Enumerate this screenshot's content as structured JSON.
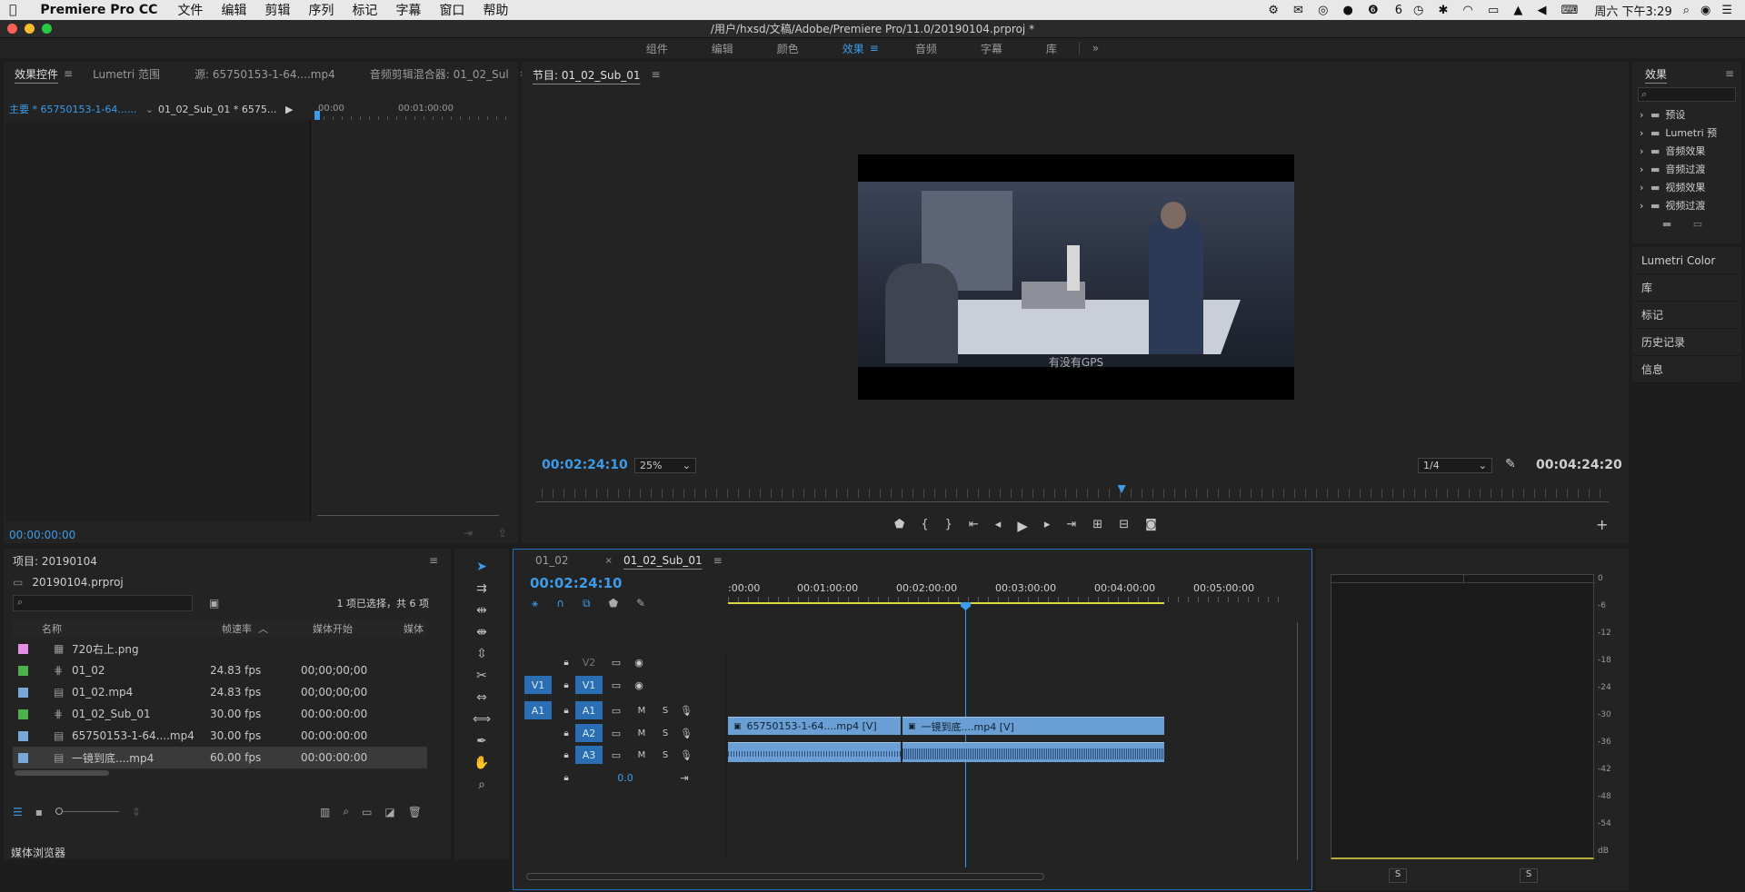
{
  "menubar": {
    "app": "Premiere Pro CC",
    "items": [
      "文件",
      "编辑",
      "剪辑",
      "序列",
      "标记",
      "字幕",
      "窗口",
      "帮助"
    ],
    "status_number": "6",
    "datetime": "周六 下午3:29"
  },
  "window": {
    "title": "/用户/hxsd/文稿/Adobe/Premiere Pro/11.0/20190104.prproj *"
  },
  "workspaces": {
    "items": [
      "组件",
      "编辑",
      "颜色",
      "效果",
      "音频",
      "字幕",
      "库"
    ],
    "active": "效果"
  },
  "effect_controls": {
    "tabs": [
      "效果控件",
      "Lumetri 范围",
      "源: 65750153-1-64....mp4",
      "音频剪辑混合器: 01_02_Sul"
    ],
    "master_clip": "主要 * 65750153-1-64......",
    "seq_clip": "01_02_Sub_01 * 6575...",
    "ruler": [
      "00:00",
      "00:01:00:00"
    ],
    "timecode": "00:00:00:00"
  },
  "program": {
    "title": "节目: 01_02_Sub_01",
    "timecode": "00:02:24:10",
    "zoom": "25%",
    "resolution": "1/4",
    "duration": "00:04:24:20",
    "subtitle": "有没有GPS",
    "playhead_fraction": 0.545
  },
  "effects_panel": {
    "title": "效果",
    "items": [
      "预设",
      "Lumetri 预",
      "音频效果",
      "音频过渡",
      "视频效果",
      "视频过渡"
    ]
  },
  "side_panels": [
    "Lumetri Color",
    "库",
    "标记",
    "历史记录",
    "信息"
  ],
  "project": {
    "title": "项目: 20190104",
    "file": "20190104.prproj",
    "selection": "1 项已选择，共 6 项",
    "columns": [
      "名称",
      "帧速率",
      "媒体开始",
      "媒体"
    ],
    "rows": [
      {
        "name": "720右上.png",
        "fps": "",
        "start": "",
        "color": "#e58ee8",
        "type": "image"
      },
      {
        "name": "01_02",
        "fps": "24.83 fps",
        "start": "00;00;00;00",
        "color": "#4cb04c",
        "type": "sequence"
      },
      {
        "name": "01_02.mp4",
        "fps": "24.83 fps",
        "start": "00;00;00;00",
        "color": "#7aa6d8",
        "type": "video"
      },
      {
        "name": "01_02_Sub_01",
        "fps": "30.00 fps",
        "start": "00:00:00:00",
        "color": "#4cb04c",
        "type": "sequence"
      },
      {
        "name": "65750153-1-64....mp4",
        "fps": "30.00 fps",
        "start": "00:00:00:00",
        "color": "#7aa6d8",
        "type": "video"
      },
      {
        "name": "一镜到底....mp4",
        "fps": "60.00 fps",
        "start": "00:00:00:00",
        "color": "#7aa6d8",
        "type": "video"
      }
    ],
    "media_browser": "媒体浏览器"
  },
  "timeline": {
    "tabs": [
      "01_02",
      "01_02_Sub_01"
    ],
    "timecode": "00:02:24:10",
    "ruler": [
      ":00:00",
      "00:01:00:00",
      "00:02:00:00",
      "00:03:00:00",
      "00:04:00:00",
      "00:05:00:00"
    ],
    "video_tracks": [
      "V2",
      "V1"
    ],
    "audio_tracks": [
      "A1",
      "A2",
      "A3"
    ],
    "source_patch_v": "V1",
    "source_patch_a": "A1",
    "mute_label": "M",
    "solo_label": "S",
    "master_level": "0.0",
    "clips": [
      {
        "label": "65750153-1-64....mp4 [V]"
      },
      {
        "label": "一镜到底....mp4 [V]"
      }
    ]
  },
  "audio_meter": {
    "ticks": [
      "0",
      "-6",
      "-12",
      "-18",
      "-24",
      "-30",
      "-36",
      "-42",
      "-48",
      "-54",
      "dB"
    ],
    "solo": [
      "S",
      "S"
    ]
  },
  "colors": {
    "accent": "#3d9be9",
    "clip": "#6a9fd6",
    "panel": "#232323"
  }
}
